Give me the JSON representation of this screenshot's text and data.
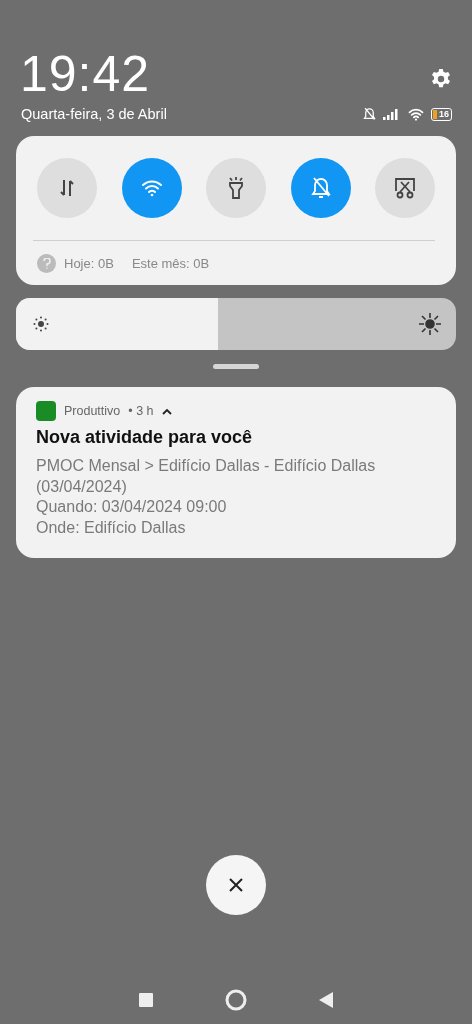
{
  "header": {
    "time": "19:42",
    "date": "Quarta-feira, 3 de Abril",
    "battery": "16"
  },
  "toggles": [
    {
      "kind": "data",
      "on": false
    },
    {
      "kind": "wifi",
      "on": true
    },
    {
      "kind": "flashlight",
      "on": false
    },
    {
      "kind": "silent",
      "on": true
    },
    {
      "kind": "screenshot",
      "on": false
    }
  ],
  "data_usage": {
    "today": "Hoje: 0B",
    "month": "Este mês: 0B"
  },
  "brightness": {
    "level": 0.46
  },
  "notification": {
    "app": "Produttivo",
    "time": "• 3 h",
    "title": "Nova atividade para você",
    "lines": [
      "PMOC Mensal > Edifício Dallas - Edifício Dallas (03/04/2024)",
      "Quando: 03/04/2024 09:00",
      "Onde: Edifício Dallas"
    ]
  }
}
